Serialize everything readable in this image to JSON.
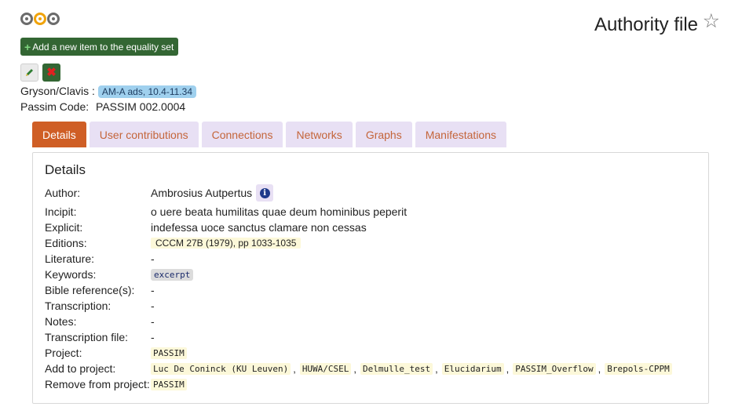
{
  "header": {
    "title": "Authority file",
    "favorite_icon": "star-outline-icon"
  },
  "toolbar": {
    "add_label": "Add a new item to the equality set"
  },
  "meta": {
    "gryson_label": "Gryson/Clavis :",
    "gryson_value": "AM-A ads, 10.4-11.34",
    "passim_label": "Passim Code:",
    "passim_value": "PASSIM 002.0004"
  },
  "tabs": [
    {
      "label": "Details"
    },
    {
      "label": "User contributions"
    },
    {
      "label": "Connections"
    },
    {
      "label": "Networks"
    },
    {
      "label": "Graphs"
    },
    {
      "label": "Manifestations"
    }
  ],
  "details": {
    "title": "Details",
    "author": {
      "label": "Author:",
      "value": "Ambrosius Autpertus"
    },
    "incipit": {
      "label": "Incipit:",
      "value": "o uere beata humilitas quae deum hominibus peperit"
    },
    "explicit": {
      "label": "Explicit:",
      "value": "indefessa uoce sanctus clamare non cessas"
    },
    "editions": {
      "label": "Editions:",
      "value": "CCCM 27B (1979), pp 1033-1035"
    },
    "literature": {
      "label": "Literature:",
      "value": "-"
    },
    "keywords": {
      "label": "Keywords:",
      "value": "excerpt"
    },
    "bible": {
      "label": "Bible reference(s):",
      "value": "-"
    },
    "transcription": {
      "label": "Transcription:",
      "value": "-"
    },
    "notes": {
      "label": "Notes:",
      "value": "-"
    },
    "transcription_file": {
      "label": "Transcription file:",
      "value": "-"
    },
    "project": {
      "label": "Project:",
      "value": "PASSIM"
    },
    "add_to_project": {
      "label": "Add to project:",
      "items": [
        "Luc De Coninck (KU Leuven)",
        "HUWA/CSEL",
        "Delmulle_test",
        "Elucidarium",
        "PASSIM_Overflow",
        "Brepols-CPPM"
      ],
      "separator": ","
    },
    "remove_from_project": {
      "label": "Remove from project:",
      "value": "PASSIM"
    }
  }
}
